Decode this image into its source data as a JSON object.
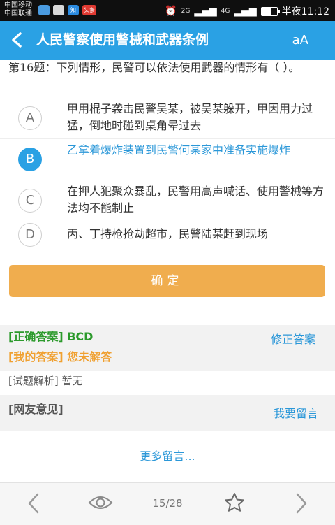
{
  "status_bar": {
    "carrier_1": "中国移动",
    "carrier_2": "中国联通",
    "app_icons": [
      "",
      "",
      "知",
      "头条"
    ],
    "network_1": "2G",
    "network_2": "4G",
    "time": "半夜11:12"
  },
  "header": {
    "back_icon": "chevron-left-icon",
    "title": "人民警察使用警械和武器条例",
    "font_size_icon": "aA"
  },
  "question": {
    "text": "第16题：下列情形，民警可以依法使用武器的情形有（ ）。",
    "options": [
      {
        "letter": "A",
        "text": "甲用棍子袭击民警吴某，被吴某躲开，甲因用力过猛，倒地时碰到桌角晕过去",
        "selected": false
      },
      {
        "letter": "B",
        "text": "乙拿着爆炸装置到民警何某家中准备实施爆炸",
        "selected": true
      },
      {
        "letter": "C",
        "text": "在押人犯聚众暴乱，民警用高声喊话、使用警械等方法均不能制止",
        "selected": false
      },
      {
        "letter": "D",
        "text": "丙、丁持枪抢劫超市，民警陆某赶到现场",
        "selected": false
      }
    ]
  },
  "confirm_label": "确定",
  "answer": {
    "correct_label": "[正确答案]",
    "correct_value": "BCD",
    "my_label": "[我的答案]",
    "my_value": "您未解答",
    "fix_label": "修正答案"
  },
  "analysis": {
    "label": "[试题解析]",
    "value": "暂无"
  },
  "comments": {
    "title": "[网友意见]",
    "leave_label": "我要留言",
    "more_label": "更多留言..."
  },
  "bottom_bar": {
    "page": "15/28",
    "prev_icon": "chevron-left-icon",
    "eye_icon": "eye-icon",
    "star_icon": "star-icon",
    "next_icon": "chevron-right-icon"
  },
  "colors": {
    "header": "#2aa1e4",
    "confirm": "#f0ad4e",
    "correct": "#2c9a2c",
    "mine": "#f0a030",
    "link": "#2a97d8"
  }
}
